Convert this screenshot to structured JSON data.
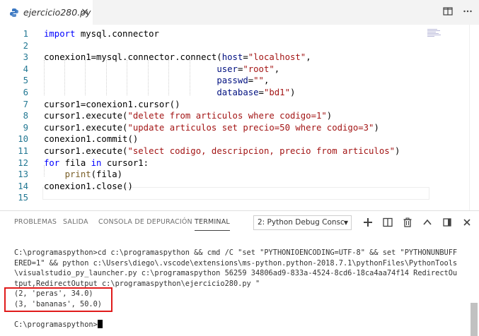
{
  "tab": {
    "filename": "ejercicio280.py",
    "close_icon": "×"
  },
  "editor": {
    "lines": [
      {
        "n": "1",
        "parts": [
          [
            "kw",
            "import"
          ],
          [
            "pl",
            " mysql.connector"
          ]
        ]
      },
      {
        "n": "2",
        "parts": []
      },
      {
        "n": "3",
        "parts": [
          [
            "pl",
            "conexion1=mysql.connector.connect("
          ],
          [
            "var",
            "host"
          ],
          [
            "pl",
            "="
          ],
          [
            "str",
            "\"localhost\""
          ],
          [
            "pl",
            ","
          ]
        ]
      },
      {
        "n": "4",
        "parts": [
          [
            "pl",
            "                                 "
          ],
          [
            "var",
            "user"
          ],
          [
            "pl",
            "="
          ],
          [
            "str",
            "\"root\""
          ],
          [
            "pl",
            ","
          ]
        ]
      },
      {
        "n": "5",
        "parts": [
          [
            "pl",
            "                                 "
          ],
          [
            "var",
            "passwd"
          ],
          [
            "pl",
            "="
          ],
          [
            "str",
            "\"\""
          ],
          [
            "pl",
            ","
          ]
        ]
      },
      {
        "n": "6",
        "parts": [
          [
            "pl",
            "                                 "
          ],
          [
            "var",
            "database"
          ],
          [
            "pl",
            "="
          ],
          [
            "str",
            "\"bd1\""
          ],
          [
            "pl",
            ")"
          ]
        ]
      },
      {
        "n": "7",
        "parts": [
          [
            "pl",
            "cursor1=conexion1.cursor()"
          ]
        ]
      },
      {
        "n": "8",
        "parts": [
          [
            "pl",
            "cursor1.execute("
          ],
          [
            "str",
            "\"delete from articulos where codigo=1\""
          ],
          [
            "pl",
            ")"
          ]
        ]
      },
      {
        "n": "9",
        "parts": [
          [
            "pl",
            "cursor1.execute("
          ],
          [
            "str",
            "\"update articulos set precio=50 where codigo=3\""
          ],
          [
            "pl",
            ")"
          ]
        ]
      },
      {
        "n": "10",
        "parts": [
          [
            "pl",
            "conexion1.commit()"
          ]
        ]
      },
      {
        "n": "11",
        "parts": [
          [
            "pl",
            "cursor1.execute("
          ],
          [
            "str",
            "\"select codigo, descripcion, precio from articulos\""
          ],
          [
            "pl",
            ")"
          ]
        ]
      },
      {
        "n": "12",
        "parts": [
          [
            "kw",
            "for"
          ],
          [
            "pl",
            " fila "
          ],
          [
            "kw",
            "in"
          ],
          [
            "pl",
            " cursor1:"
          ]
        ]
      },
      {
        "n": "13",
        "parts": [
          [
            "pl",
            "    "
          ],
          [
            "fn",
            "print"
          ],
          [
            "pl",
            "(fila)"
          ]
        ]
      },
      {
        "n": "14",
        "parts": [
          [
            "pl",
            "conexion1.close()"
          ]
        ]
      },
      {
        "n": "15",
        "parts": []
      }
    ]
  },
  "panel": {
    "tabs": [
      "PROBLEMAS",
      "SALIDA",
      "CONSOLA DE DEPURACIÓN",
      "TERMINAL"
    ],
    "terminal_select": "2: Python Debug Consc",
    "terminal_lines": [
      "C:\\programaspython>cd c:\\programaspython && cmd /C \"set \"PYTHONIOENCODING=UTF-8\" && set \"PYTHONUNBUFF",
      "ERED=1\" && python c:\\Users\\diego\\.vscode\\extensions\\ms-python.python-2018.7.1\\pythonFiles\\PythonTools",
      "\\visualstudio_py_launcher.py c:\\programaspython 56259 34806ad9-833a-4524-8cd6-18ca4aa74f14 RedirectOu",
      "tput,RedirectOutput c:\\programaspython\\ejercicio280.py \"",
      "(2, 'peras', 34.0)",
      "(3, 'bananas', 50.0)",
      "",
      "C:\\programaspython>"
    ]
  },
  "colors": {
    "highlight_box": "#e01b1b",
    "keyword": "#0000ff",
    "string": "#a31515",
    "line_number": "#237893"
  }
}
